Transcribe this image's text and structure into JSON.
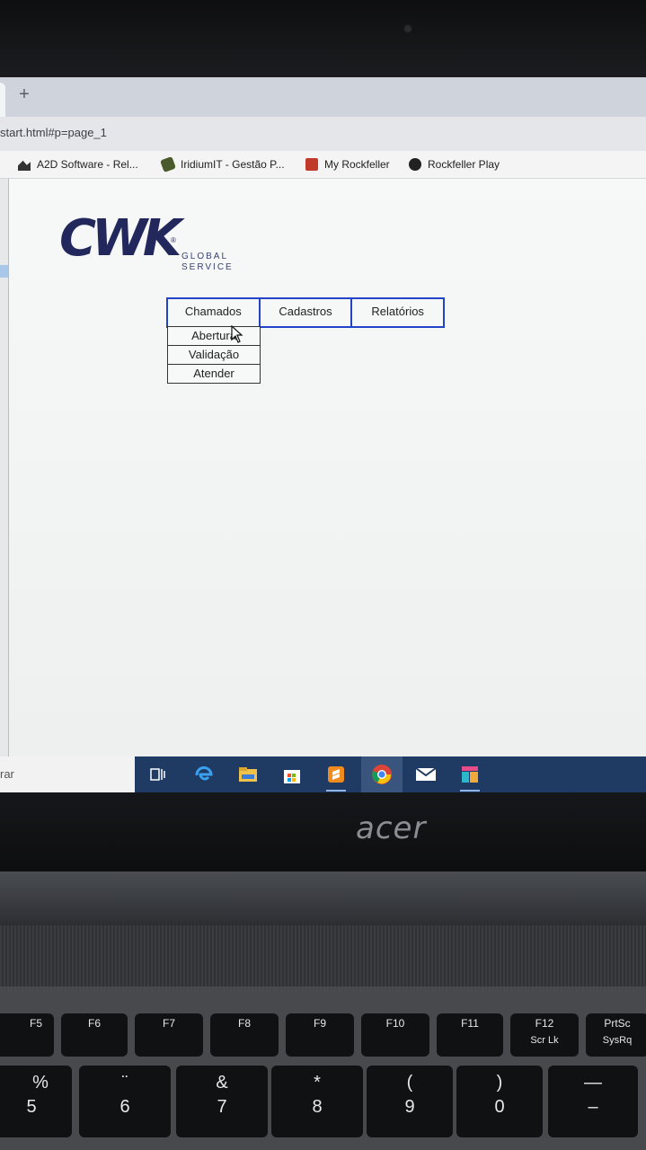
{
  "browser": {
    "new_tab_icon": "+",
    "url": "start.html#p=page_1",
    "bookmarks": [
      {
        "label": "A2D Software - Rel...",
        "icon": "a2d-icon"
      },
      {
        "label": "IridiumIT - Gestão P...",
        "icon": "iridium-icon"
      },
      {
        "label": "My Rockfeller",
        "icon": "rockfeller-icon"
      },
      {
        "label": "Rockfeller Play",
        "icon": "play-icon"
      }
    ]
  },
  "logo": {
    "mark": "CWK",
    "registered": "®",
    "tagline_line1": "GLOBAL",
    "tagline_line2": "SERVICE"
  },
  "menu": {
    "items": [
      {
        "label": "Chamados"
      },
      {
        "label": "Cadastros"
      },
      {
        "label": "Relatórios"
      }
    ],
    "submenu": [
      {
        "label": "Abertura"
      },
      {
        "label": "Validação"
      },
      {
        "label": "Atender"
      }
    ]
  },
  "taskbar": {
    "search_text": "rar",
    "apps": [
      "task-view-icon",
      "edge-icon",
      "file-explorer-icon",
      "store-icon",
      "sublime-icon",
      "chrome-icon",
      "mail-icon",
      "app-icon"
    ]
  },
  "hardware": {
    "brand": "acer",
    "fn_keys": [
      {
        "label": "F5"
      },
      {
        "label": "F6"
      },
      {
        "label": "F7"
      },
      {
        "label": "F8"
      },
      {
        "label": "F9"
      },
      {
        "label": "F10"
      },
      {
        "label": "F11"
      },
      {
        "label": "F12",
        "sub": "Scr Lk"
      },
      {
        "label": "PrtSc",
        "sub": "SysRq"
      }
    ],
    "number_keys": [
      {
        "top": "%",
        "bottom": "5"
      },
      {
        "top": "¨",
        "bottom": "6"
      },
      {
        "top": "&",
        "bottom": "7"
      },
      {
        "top": "*",
        "bottom": "8"
      },
      {
        "top": "(",
        "bottom": "9"
      },
      {
        "top": ")",
        "bottom": "0"
      },
      {
        "top": "—",
        "bottom": "–"
      }
    ]
  }
}
